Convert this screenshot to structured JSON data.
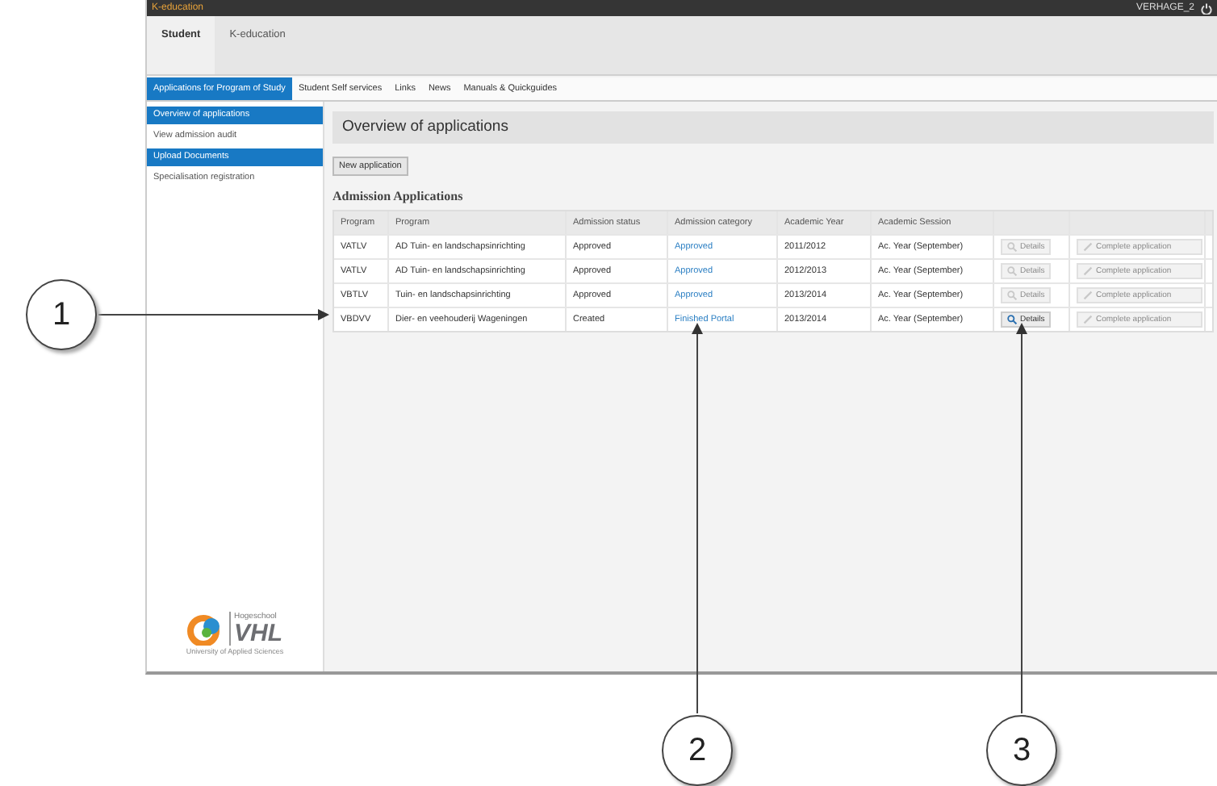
{
  "app": {
    "brand": "K-education",
    "user": "VERHAGE_2",
    "tabs": [
      {
        "label": "Student",
        "selected": true
      },
      {
        "label": "K-education",
        "selected": false
      }
    ],
    "nav": [
      {
        "label": "Applications for Program of Study",
        "selected": true
      },
      {
        "label": "Student Self services",
        "selected": false
      },
      {
        "label": "Links",
        "selected": false
      },
      {
        "label": "News",
        "selected": false
      },
      {
        "label": "Manuals & Quickguides",
        "selected": false
      }
    ],
    "sidebar": {
      "items": [
        {
          "label": "Overview of applications",
          "selected": true
        },
        {
          "label": "View admission audit",
          "selected": false
        },
        {
          "label": "Upload Documents",
          "selected": true
        },
        {
          "label": "Specialisation registration",
          "selected": false
        }
      ],
      "logo": {
        "top": "Hogeschool",
        "name": "VHL",
        "tagline": "University of Applied Sciences"
      }
    },
    "page_title": "Overview of applications",
    "new_button": "New application",
    "section_title": "Admission Applications",
    "table": {
      "columns": [
        "Program",
        "Program",
        "Admission status",
        "Admission category",
        "Academic Year",
        "Academic Session"
      ],
      "rows": [
        {
          "code": "VATLV",
          "program": "AD Tuin- en landschapsinrichting",
          "status": "Approved",
          "category": "Approved",
          "year": "2011/2012",
          "session": "Ac. Year (September)",
          "details": {
            "label": "Details",
            "disabled": true
          },
          "complete": {
            "label": "Complete application",
            "disabled": true
          }
        },
        {
          "code": "VATLV",
          "program": "AD Tuin- en landschapsinrichting",
          "status": "Approved",
          "category": "Approved",
          "year": "2012/2013",
          "session": "Ac. Year (September)",
          "details": {
            "label": "Details",
            "disabled": true
          },
          "complete": {
            "label": "Complete application",
            "disabled": true
          }
        },
        {
          "code": "VBTLV",
          "program": "Tuin- en landschapsinrichting",
          "status": "Approved",
          "category": "Approved",
          "year": "2013/2014",
          "session": "Ac. Year (September)",
          "details": {
            "label": "Details",
            "disabled": true
          },
          "complete": {
            "label": "Complete application",
            "disabled": true
          }
        },
        {
          "code": "VBDVV",
          "program": "Dier- en veehouderij Wageningen",
          "status": "Created",
          "category": "Finished Portal",
          "year": "2013/2014",
          "session": "Ac. Year (September)",
          "details": {
            "label": "Details",
            "disabled": false
          },
          "complete": {
            "label": "Complete application",
            "disabled": true
          }
        }
      ]
    }
  },
  "callouts": [
    {
      "label": "1"
    },
    {
      "label": "2"
    },
    {
      "label": "3"
    }
  ]
}
